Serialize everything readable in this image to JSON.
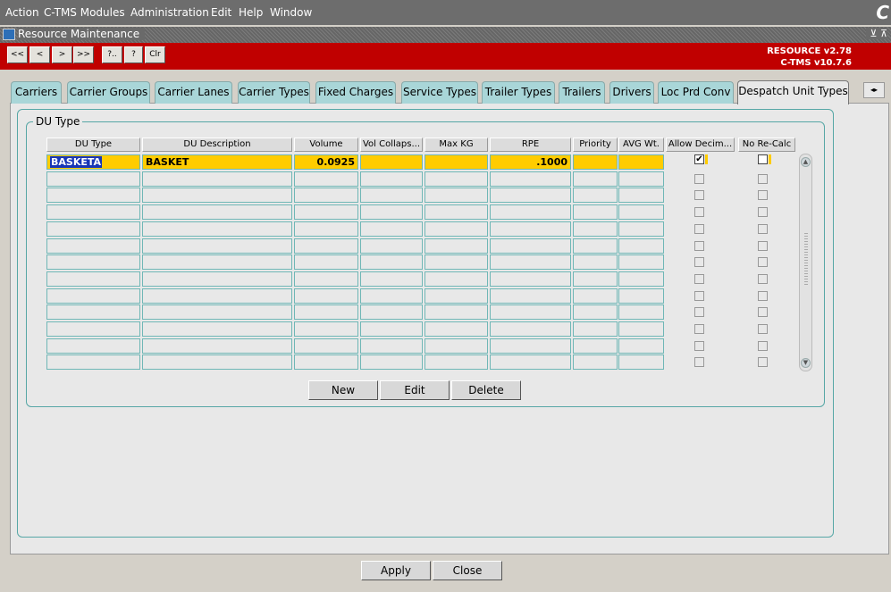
{
  "menubar": {
    "items": [
      "Action",
      "C-TMS Modules",
      "Administration",
      "Edit",
      "Help",
      "Window"
    ],
    "logo": "C"
  },
  "window": {
    "title": "Resource Maintenance",
    "controls": "⊻ ⊼"
  },
  "toolbar": {
    "buttons": [
      "<<",
      "<",
      ">",
      ">>",
      "?..",
      "?",
      "Clr"
    ],
    "version_line1": "RESOURCE v2.78",
    "version_line2": "C-TMS v10.7.6"
  },
  "tabs": [
    "Carriers",
    "Carrier Groups",
    "Carrier Lanes",
    "Carrier Types",
    "Fixed Charges",
    "Service Types",
    "Trailer Types",
    "Trailers",
    "Drivers",
    "Loc Prd Conv",
    "Despatch Unit Types"
  ],
  "active_tab": "Despatch Unit Types",
  "group": {
    "label": "DU Type",
    "columns": [
      "DU Type",
      "DU Description",
      "Volume",
      "Vol Collaps...",
      "Max KG",
      "RPE",
      "Priority",
      "AVG Wt.",
      "Allow Decim...",
      "No Re-Calc"
    ],
    "rows": [
      {
        "du_type": "BASKETA",
        "description": "BASKET",
        "volume": "0.0925",
        "vol_collapse": "",
        "max_kg": "",
        "rpe": ".1000",
        "priority": "",
        "avg_wt": "",
        "allow_decimal": true,
        "no_recalc": false
      }
    ],
    "buttons": {
      "new": "New",
      "edit": "Edit",
      "delete": "Delete"
    }
  },
  "footer": {
    "apply": "Apply",
    "close": "Close"
  }
}
